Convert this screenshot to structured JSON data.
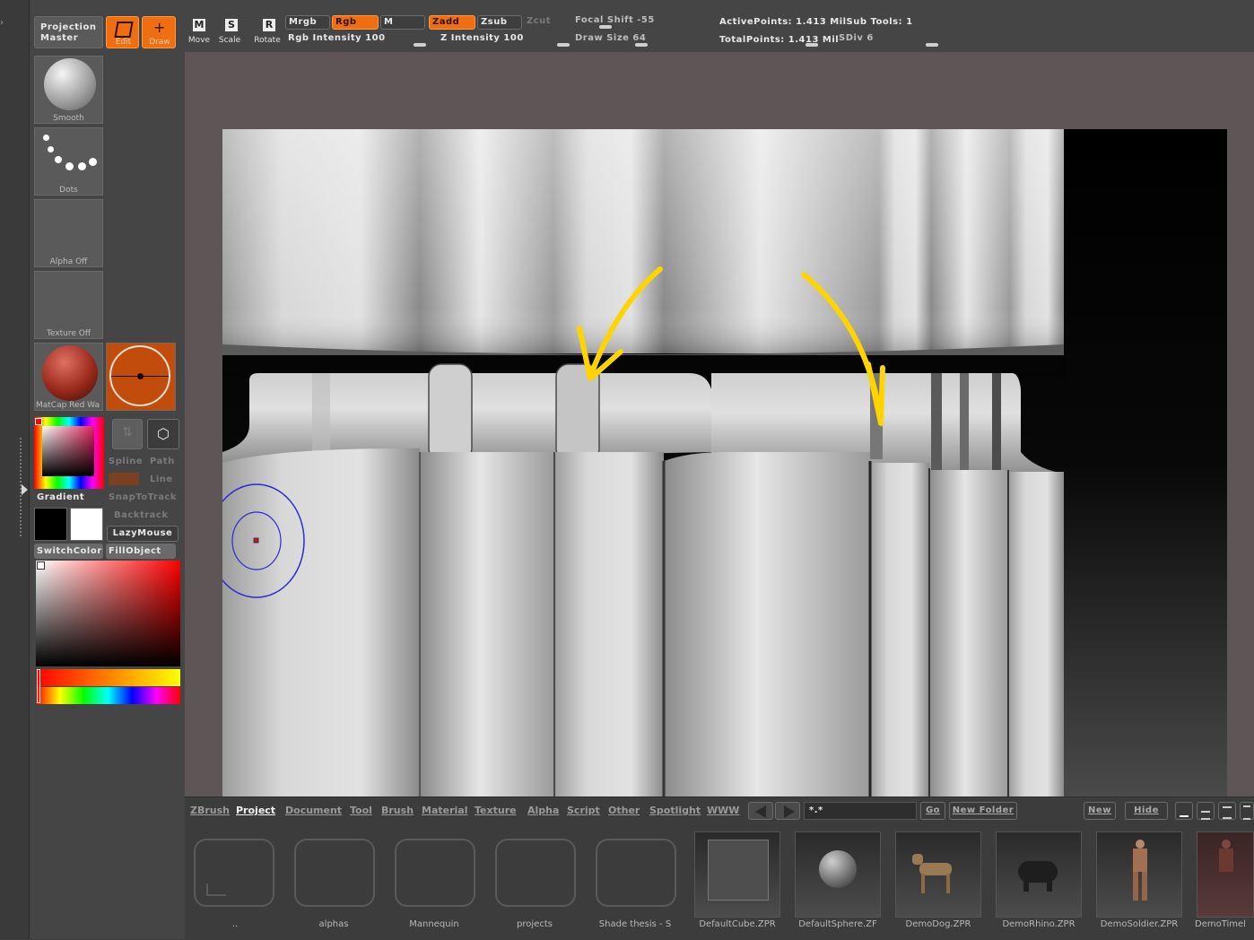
{
  "toolbar": {
    "projection_master": "Projection Master",
    "edit": "Edit",
    "draw": "Draw",
    "move": "Move",
    "scale": "Scale",
    "rotate": "Rotate",
    "move_key": "M",
    "scale_key": "S",
    "rotate_key": "R",
    "mrgb": "Mrgb",
    "rgb": "Rgb",
    "m": "M",
    "zadd": "Zadd",
    "zsub": "Zsub",
    "zcut": "Zcut",
    "rgb_intensity": "Rgb  Intensity 100",
    "z_intensity": "Z  Intensity 100",
    "focal_shift": "Focal  Shift -55",
    "draw_size": "Draw  Size 64",
    "active_points": "ActivePoints: 1.413  MilSub  Tools: 1",
    "total_points": "TotalPoints: 1.413  Mil",
    "sdiv": "SDiv 6"
  },
  "left_panel": {
    "smooth": "Smooth",
    "dots": "Dots",
    "alpha_off": "Alpha  Off",
    "texture_off": "Texture  Off",
    "matcap": "MatCap  Red  Wa",
    "gradient": "Gradient",
    "spline": "Spline",
    "path": "Path",
    "line": "Line",
    "snap_to_track": "SnapToTrack",
    "backtrack": "Backtrack",
    "lazy_mouse": "LazyMouse",
    "switch_color": "SwitchColor",
    "fill_object": "FillObject"
  },
  "browser": {
    "tabs": [
      "ZBrush",
      "Project",
      "Document",
      "Tool",
      "Brush",
      "Material",
      "Texture",
      "Alpha",
      "Script",
      "Other",
      "Spotlight",
      "WWW"
    ],
    "active_tab": "Project",
    "search_value": "*.*",
    "go": "Go",
    "new_folder": "New  Folder",
    "new": "New",
    "hide": "Hide",
    "folders": [
      "..",
      "alphas",
      "Mannequin",
      "projects",
      "Shade  thesis - S"
    ],
    "files": [
      "DefaultCube.ZPR",
      "DefaultSphere.ZF",
      "DemoDog.ZPR",
      "DemoRhino.ZPR",
      "DemoSoldier.ZPR",
      "DemoTimel"
    ]
  },
  "colors": {
    "accent_orange": "#f06e12",
    "annotation_yellow": "#ffd400",
    "brush_cursor_blue": "#2a2ad8"
  }
}
